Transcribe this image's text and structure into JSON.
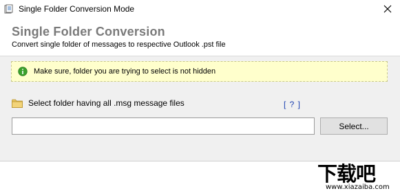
{
  "window": {
    "title": "Single Folder Conversion Mode",
    "close_glyph": "✕"
  },
  "header": {
    "title": "Single Folder Conversion",
    "subtitle": "Convert single folder of messages to respective Outlook .pst file"
  },
  "notice": {
    "icon": "info-icon",
    "text": "Make sure, folder you are trying to select is not hidden"
  },
  "folder_select": {
    "icon": "folder-icon",
    "label": "Select folder having all .msg message files",
    "help_label": "[ ? ]",
    "path_value": "",
    "button_label": "Select..."
  },
  "watermark": {
    "glyphs": "下载吧",
    "url": "www.xiazaiba.com"
  },
  "colors": {
    "header_title": "#7a7a7a",
    "notice_bg": "#ffffcc",
    "content_bg": "#f0f0f0",
    "help_link": "#1a3fb0",
    "info_icon": "#3aa12c",
    "folder": "#e8c560"
  }
}
